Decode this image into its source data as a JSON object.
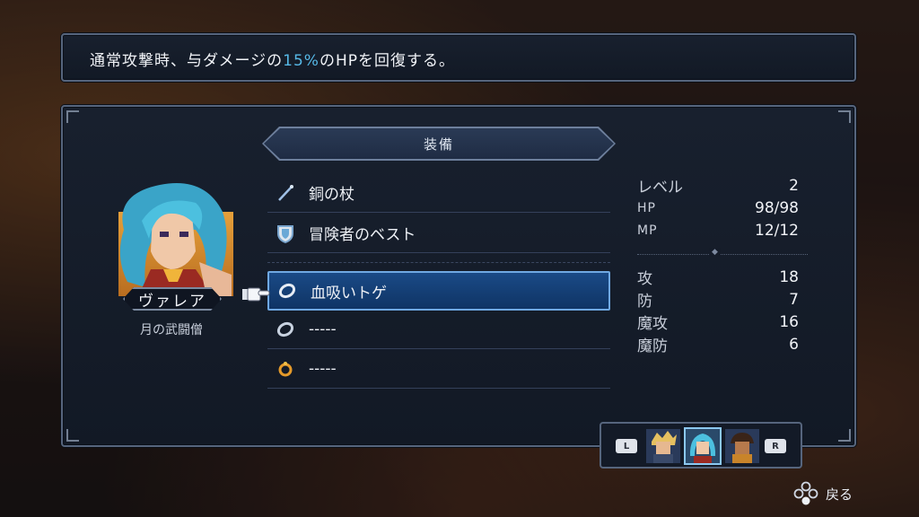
{
  "description": {
    "before": "通常攻撃時、与ダメージの",
    "highlight": "15%",
    "after": "のHPを回復する。"
  },
  "character": {
    "name": "ヴァレア",
    "class": "月の武闘僧"
  },
  "equip": {
    "header": "装備",
    "slots": [
      {
        "label": "銅の杖",
        "icon": "staff-icon"
      },
      {
        "label": "冒険者のベスト",
        "icon": "armor-icon"
      },
      {
        "label": "血吸いトゲ",
        "icon": "ring-icon"
      },
      {
        "label": "-----",
        "icon": "ring-icon"
      },
      {
        "label": "-----",
        "icon": "amulet-icon"
      }
    ],
    "selected_index": 2
  },
  "stats": {
    "level_label": "レベル",
    "level": "2",
    "hp_label": "HP",
    "hp": "98/98",
    "mp_label": "MP",
    "mp": "12/12",
    "atk_label": "攻",
    "atk": "18",
    "def_label": "防",
    "def": "7",
    "matk_label": "魔攻",
    "matk": "16",
    "mdef_label": "魔防",
    "mdef": "6"
  },
  "party": {
    "left_button": "L",
    "right_button": "R",
    "selected_member": 2
  },
  "hint": {
    "back_label": "戻る"
  }
}
